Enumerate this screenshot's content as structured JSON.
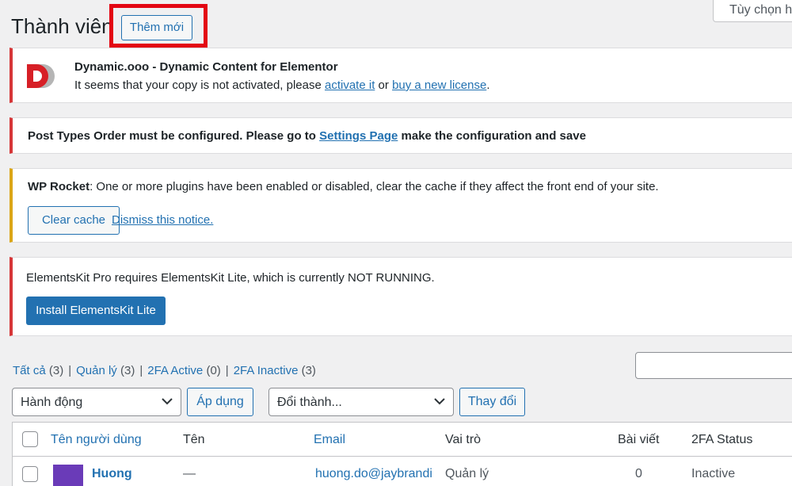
{
  "screen_options": {
    "label": "Tùy chọn hiển thị"
  },
  "header": {
    "title": "Thành viên",
    "add_new_label": "Thêm mới"
  },
  "notices": {
    "dynamic": {
      "logo_letter": "D",
      "title": "Dynamic.ooo - Dynamic Content for Elementor",
      "msg_before": "It seems that your copy is not activated, please ",
      "link1": "activate it",
      "msg_mid": " or ",
      "link2": "buy a new license",
      "msg_after": "."
    },
    "post_types": {
      "msg_before": "Post Types Order must be configured. Please go to ",
      "link": "Settings Page",
      "msg_after": " make the configuration and save"
    },
    "wp_rocket": {
      "brand": "WP Rocket",
      "msg": ": One or more plugins have been enabled or disabled, clear the cache if they affect the front end of your site.",
      "clear_label": "Clear cache",
      "dismiss_label": "Dismiss this notice."
    },
    "elementskit": {
      "msg": "ElementsKit Pro requires ElementsKit Lite, which is currently NOT RUNNING.",
      "install_label": "Install ElementsKit Lite"
    }
  },
  "filters": [
    {
      "label": "Tất cả",
      "count": "(3)"
    },
    {
      "label": "Quản lý",
      "count": "(3)"
    },
    {
      "label": "2FA Active",
      "count": "(0)"
    },
    {
      "label": "2FA Inactive",
      "count": "(3)"
    }
  ],
  "separator": "|",
  "bulk_actions": {
    "selected": "Hành động",
    "apply_label": "Áp dụng"
  },
  "change_role": {
    "selected": "Đổi thành...",
    "button_label": "Thay đổi"
  },
  "table": {
    "columns": [
      "Tên người dùng",
      "Tên",
      "Email",
      "Vai trò",
      "Bài viết",
      "2FA Status"
    ],
    "rows": [
      {
        "username": "Huong",
        "name": "—",
        "email": "huong.do@jaybrandi",
        "role": "Quản lý",
        "posts": "0",
        "twofa": "Inactive"
      }
    ]
  },
  "colors": {
    "accent": "#2271b1",
    "error": "#d63638",
    "warning": "#dba617",
    "highlight": "#e30613",
    "avatar": "#6a3bb8"
  },
  "icons": [
    "dynamic-logo-icon",
    "chevron-down-icon"
  ]
}
